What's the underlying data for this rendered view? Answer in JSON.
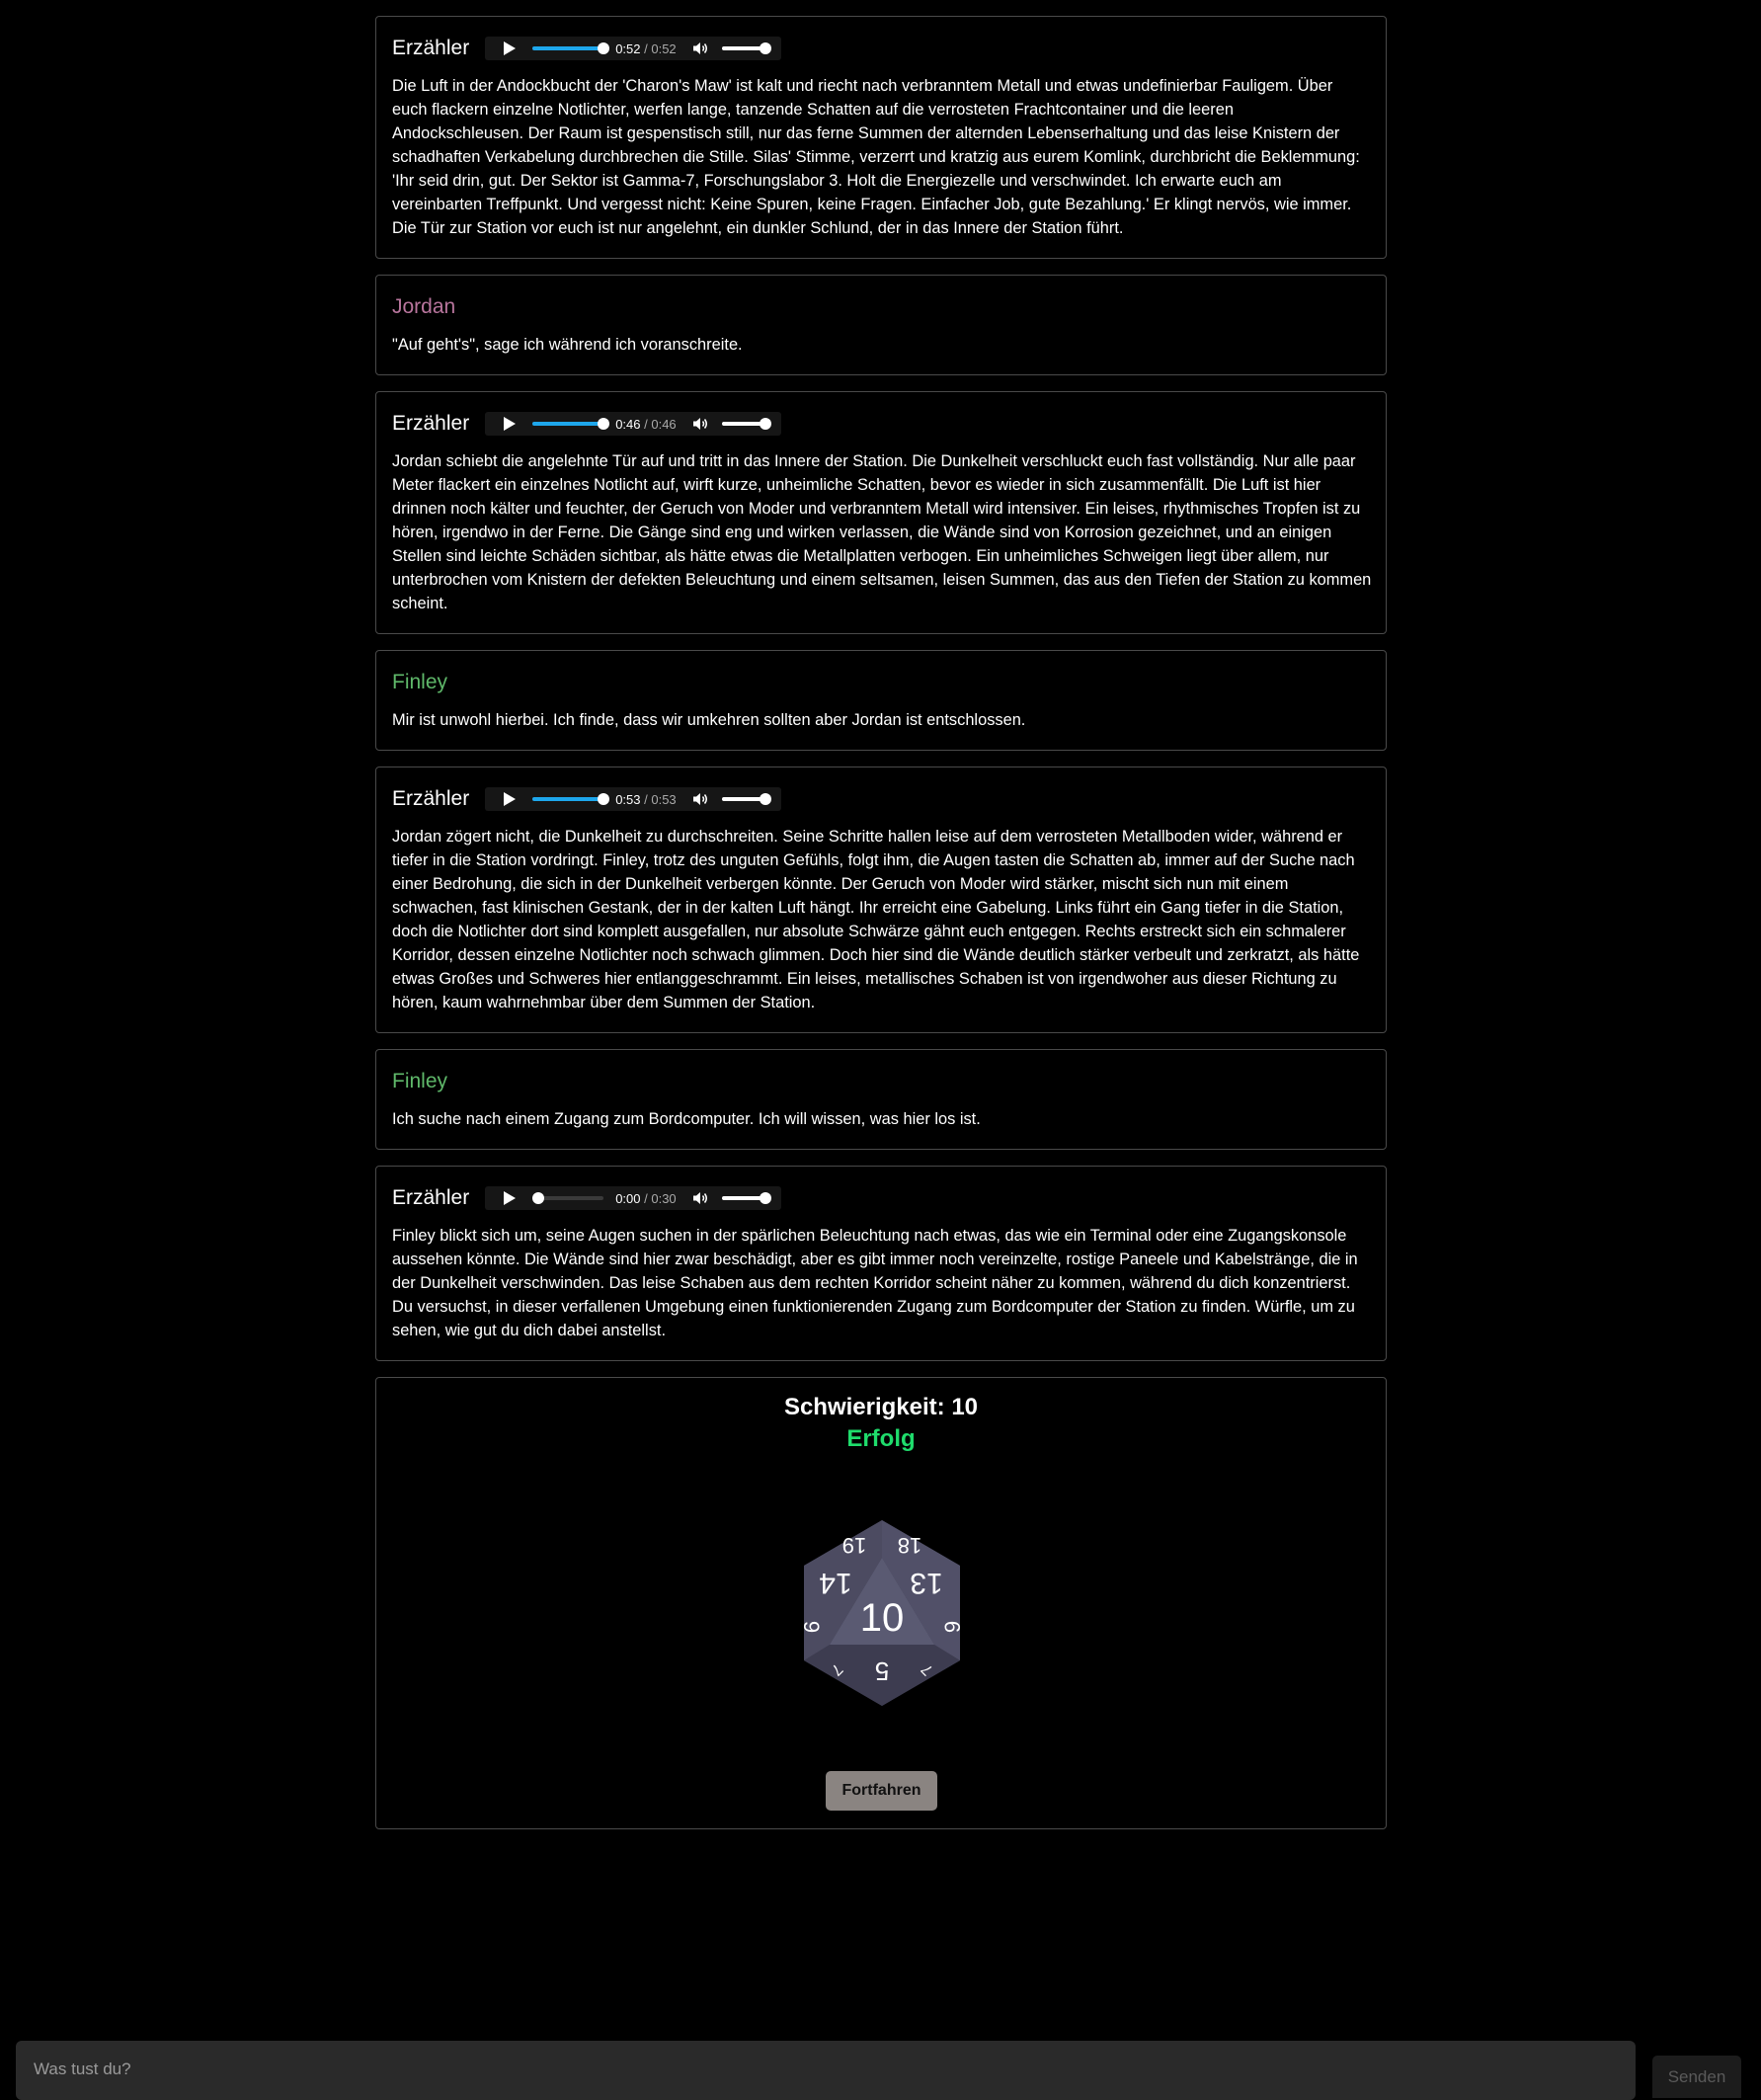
{
  "messages": [
    {
      "speaker": "Erzähler",
      "audio": {
        "current": "0:52",
        "sep": " / ",
        "duration": "0:52",
        "progress": 1.0,
        "volume": 1.0
      },
      "lines": [
        "Die Luft in der Andockbucht der 'Charon's Maw' ist kalt und riecht nach verbranntem Metall und etwas undefinierbar Fauligem. Über",
        "euch flackern einzelne Notlichter, werfen lange, tanzende Schatten auf die verrosteten Frachtcontainer und die leeren",
        "Andockschleusen. Der Raum ist gespenstisch still, nur das ferne Summen der alternden Lebenserhaltung und das leise Knistern der",
        "schadhaften Verkabelung durchbrechen die Stille. Silas' Stimme, verzerrt und kratzig aus eurem Komlink, durchbricht die Beklemmung:",
        "'Ihr seid drin, gut. Der Sektor ist Gamma-7, Forschungslabor 3. Holt die Energiezelle und verschwindet. Ich erwarte euch am",
        "vereinbarten Treffpunkt. Und vergesst nicht: Keine Spuren, keine Fragen. Einfacher Job, gute Bezahlung.' Er klingt nervös, wie immer.",
        "Die Tür zur Station vor euch ist nur angelehnt, ein dunkler Schlund, der in das Innere der Station führt."
      ]
    },
    {
      "speaker": "Jordan",
      "lines": [
        "\"Auf geht's\", sage ich während ich voranschreite."
      ]
    },
    {
      "speaker": "Erzähler",
      "audio": {
        "current": "0:46",
        "sep": " / ",
        "duration": "0:46",
        "progress": 1.0,
        "volume": 1.0
      },
      "lines": [
        "Jordan schiebt die angelehnte Tür auf und tritt in das Innere der Station. Die Dunkelheit verschluckt euch fast vollständig. Nur alle paar",
        "Meter flackert ein einzelnes Notlicht auf, wirft kurze, unheimliche Schatten, bevor es wieder in sich zusammenfällt. Die Luft ist hier",
        "drinnen noch kälter und feuchter, der Geruch von Moder und verbranntem Metall wird intensiver. Ein leises, rhythmisches Tropfen ist zu",
        "hören, irgendwo in der Ferne. Die Gänge sind eng und wirken verlassen, die Wände sind von Korrosion gezeichnet, und an einigen",
        "Stellen sind leichte Schäden sichtbar, als hätte etwas die Metallplatten verbogen. Ein unheimliches Schweigen liegt über allem, nur",
        "unterbrochen vom Knistern der defekten Beleuchtung und einem seltsamen, leisen Summen, das aus den Tiefen der Station zu kommen",
        "scheint."
      ]
    },
    {
      "speaker": "Finley",
      "lines": [
        "Mir ist unwohl hierbei. Ich finde, dass wir umkehren sollten aber Jordan ist entschlossen."
      ]
    },
    {
      "speaker": "Erzähler",
      "audio": {
        "current": "0:53",
        "sep": " / ",
        "duration": "0:53",
        "progress": 1.0,
        "volume": 1.0
      },
      "lines": [
        "Jordan zögert nicht, die Dunkelheit zu durchschreiten. Seine Schritte hallen leise auf dem verrosteten Metallboden wider, während er",
        "tiefer in die Station vordringt. Finley, trotz des unguten Gefühls, folgt ihm, die Augen tasten die Schatten ab, immer auf der Suche nach",
        "einer Bedrohung, die sich in der Dunkelheit verbergen könnte. Der Geruch von Moder wird stärker, mischt sich nun mit einem",
        "schwachen, fast klinischen Gestank, der in der kalten Luft hängt. Ihr erreicht eine Gabelung. Links führt ein Gang tiefer in die Station,",
        "doch die Notlichter dort sind komplett ausgefallen, nur absolute Schwärze gähnt euch entgegen. Rechts erstreckt sich ein schmalerer",
        "Korridor, dessen einzelne Notlichter noch schwach glimmen. Doch hier sind die Wände deutlich stärker verbeult und zerkratzt, als hätte",
        "etwas Großes und Schweres hier entlanggeschrammt. Ein leises, metallisches Schaben ist von irgendwoher aus dieser Richtung zu",
        "hören, kaum wahrnehmbar über dem Summen der Station."
      ]
    },
    {
      "speaker": "Finley",
      "lines": [
        "Ich suche nach einem Zugang zum Bordcomputer. Ich will wissen, was hier los ist."
      ]
    },
    {
      "speaker": "Erzähler",
      "audio": {
        "current": "0:00",
        "sep": " / ",
        "duration": "0:30",
        "progress": 0.0,
        "volume": 1.0
      },
      "lines": [
        "Finley blickt sich um, seine Augen suchen in der spärlichen Beleuchtung nach etwas, das wie ein Terminal oder eine Zugangskonsole",
        "aussehen könnte. Die Wände sind hier zwar beschädigt, aber es gibt immer noch vereinzelte, rostige Paneele und Kabelstränge, die in",
        "der Dunkelheit verschwinden. Das leise Schaben aus dem rechten Korridor scheint näher zu kommen, während du dich konzentrierst.",
        "Du versuchst, in dieser verfallenen Umgebung einen funktionierenden Zugang zum Bordcomputer der Station zu finden. Würfle, um zu",
        "sehen, wie gut du dich dabei anstellst."
      ]
    }
  ],
  "roll": {
    "difficulty": "Schwierigkeit: 10",
    "result": "Erfolg",
    "result_color": "#1fdc6c",
    "die": {
      "center": "10",
      "faces": [
        "19",
        "18",
        "14",
        "13",
        "9",
        "9",
        "5",
        "7",
        "7"
      ]
    },
    "continue_label": "Fortfahren"
  },
  "composer": {
    "placeholder": "Was tust du?",
    "send_label": "Senden"
  }
}
